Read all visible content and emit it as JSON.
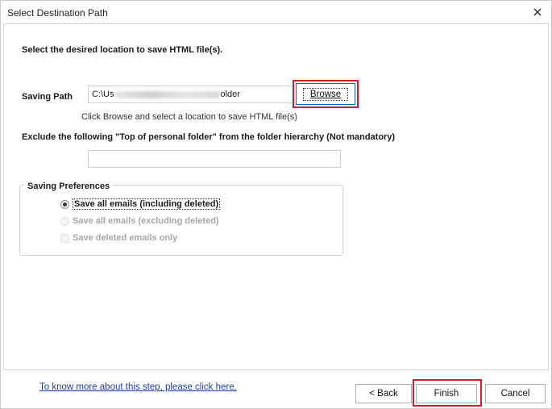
{
  "window": {
    "title": "Select Destination Path",
    "close_icon": "close-icon"
  },
  "content": {
    "heading": "Select the desired location to save HTML file(s).",
    "saving_path": {
      "label": "Saving Path",
      "value_prefix": "C:\\Us",
      "value_suffix": "older",
      "browse_label": "Browse",
      "hint": "Click Browse and select a location to save HTML file(s)"
    },
    "exclude": {
      "label": "Exclude the following \"Top of personal folder\" from the folder hierarchy  (Not mandatory)",
      "value": ""
    },
    "preferences": {
      "title": "Saving Preferences",
      "options": [
        {
          "label": "Save all emails (including deleted)",
          "type": "radio",
          "checked": true,
          "enabled": true
        },
        {
          "label": "Save all emails (excluding deleted)",
          "type": "radio",
          "checked": false,
          "enabled": false
        },
        {
          "label": "Save deleted emails only",
          "type": "checkbox",
          "checked": false,
          "enabled": false
        }
      ]
    }
  },
  "footer": {
    "help_link": "To know more about this step, please click here.",
    "back_label": "< Back",
    "finish_label": "Finish",
    "cancel_label": "Cancel"
  },
  "colors": {
    "highlight": "#c8202f",
    "link": "#1c3f9e",
    "focus_border": "#0a64c8"
  }
}
